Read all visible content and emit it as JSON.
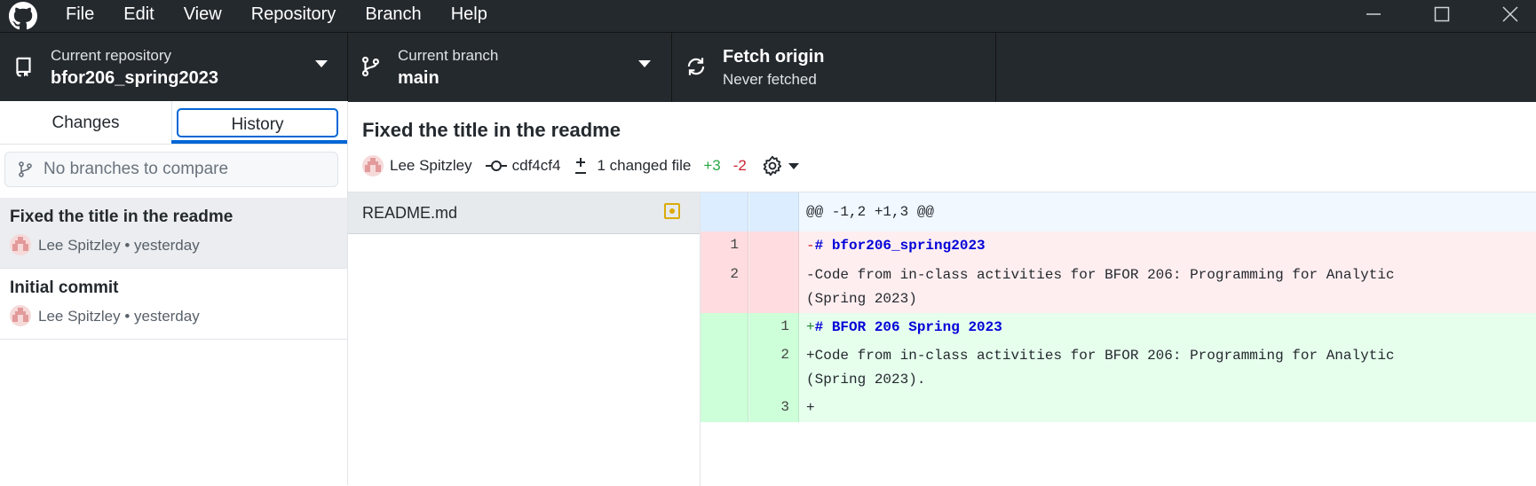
{
  "menu": [
    "File",
    "Edit",
    "View",
    "Repository",
    "Branch",
    "Help"
  ],
  "toolbar": {
    "repo_label": "Current repository",
    "repo_value": "bfor206_spring2023",
    "branch_label": "Current branch",
    "branch_value": "main",
    "fetch_label": "Fetch origin",
    "fetch_sub": "Never fetched"
  },
  "sidebar": {
    "tab_changes": "Changes",
    "tab_history": "History",
    "compare_placeholder": "No branches to compare",
    "commits": [
      {
        "title": "Fixed the title in the readme",
        "meta": "Lee Spitzley • yesterday"
      },
      {
        "title": "Initial commit",
        "meta": "Lee Spitzley • yesterday"
      }
    ]
  },
  "commit": {
    "title": "Fixed the title in the readme",
    "author": "Lee Spitzley",
    "sha": "cdf4cf4",
    "changed_files": "1 changed file",
    "additions": "+3",
    "deletions": "-2"
  },
  "files": [
    {
      "name": "README.md",
      "status": "modified"
    }
  ],
  "diff": {
    "hunk": "@@ -1,2 +1,3 @@",
    "lines": [
      {
        "type": "del",
        "old": "1",
        "new": "",
        "prefix": "-",
        "text": "# bfor206_spring2023",
        "heading": true
      },
      {
        "type": "del",
        "old": "2",
        "new": "",
        "prefix": "-",
        "text": "Code from in-class activities for BFOR 206: Programming for Analytic",
        "cont": "(Spring 2023)"
      },
      {
        "type": "add",
        "old": "",
        "new": "1",
        "prefix": "+",
        "text": "# BFOR 206 Spring 2023",
        "heading": true
      },
      {
        "type": "add",
        "old": "",
        "new": "2",
        "prefix": "+",
        "text": "Code from in-class activities for BFOR 206: Programming for Analytic",
        "cont": "(Spring 2023)."
      },
      {
        "type": "add",
        "old": "",
        "new": "3",
        "prefix": "+",
        "text": ""
      }
    ]
  },
  "colors": {
    "titlebar": "#24292e",
    "accent": "#0366d6",
    "added": "#28a745",
    "deleted": "#cb2431",
    "modified": "#dbab09"
  }
}
